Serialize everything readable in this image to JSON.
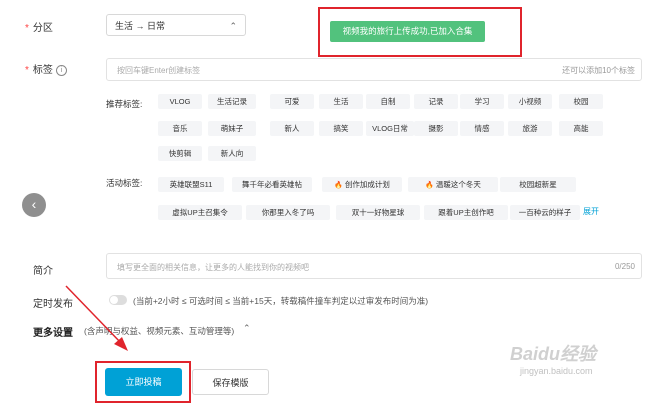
{
  "partition": {
    "label": "分区",
    "value": "生活 → 日常"
  },
  "toast": {
    "text": "视频我的旅行上传成功,已加入合集"
  },
  "tags": {
    "label": "标签",
    "placeholder": "按回车键Enter创建标签",
    "remaining": "还可以添加10个标签",
    "recommended_label": "推荐标签:",
    "recommended": [
      "VLOG",
      "生活记录",
      "可爱",
      "生活",
      "自制",
      "记录",
      "学习",
      "小视频",
      "校园",
      "音乐",
      "萌妹子",
      "新人",
      "搞笑",
      "VLOG日常",
      "摄影",
      "情感",
      "旅游",
      "高能",
      "快剪辑",
      "新人向"
    ],
    "activity_label": "活动标签:",
    "activity": [
      "英雄联盟S11",
      "舞千年必看英雄帖",
      "创作加成计划",
      "温暖这个冬天",
      "校园超新星",
      "虚拟UP主召集令",
      "你那里入冬了吗",
      "双十一好物星球",
      "跟着UP主创作吧",
      "一百种云的样子"
    ],
    "expand": "展开"
  },
  "intro": {
    "label": "简介",
    "placeholder": "填写更全面的相关信息，让更多的人能找到你的视频吧",
    "counter": "0/250"
  },
  "schedule": {
    "label": "定时发布",
    "hint": "(当前+2小时 ≤ 可选时间 ≤ 当前+15天，转载稿件撞车判定以过审发布时间为准)"
  },
  "more": {
    "label": "更多设置",
    "desc": "(含声明与权益、视频元素、互动管理等)"
  },
  "buttons": {
    "submit": "立即投稿",
    "draft": "保存模版"
  },
  "watermark": {
    "brand": "Baidu经验",
    "url": "jingyan.baidu.com"
  },
  "colors": {
    "accent": "#00a1d6",
    "toast": "#52c27d",
    "highlight": "#e0242c",
    "required": "#ff4444"
  }
}
